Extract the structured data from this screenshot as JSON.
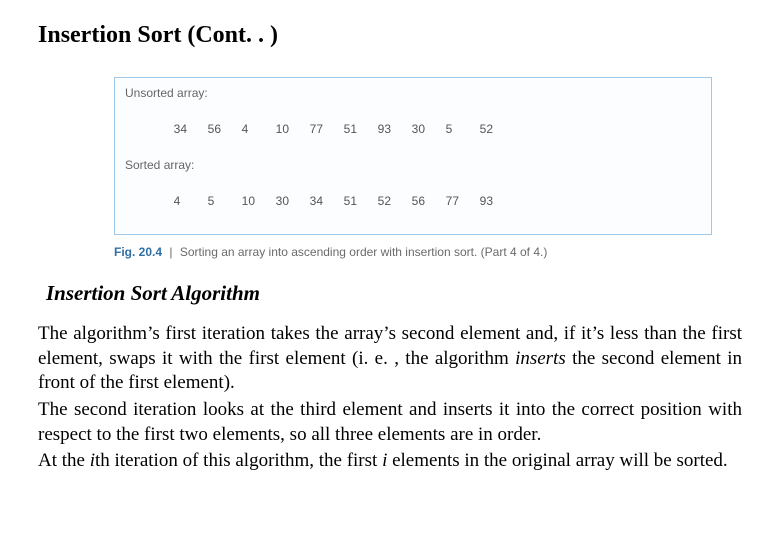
{
  "title": "Insertion Sort (Cont. . )",
  "figure": {
    "unsorted_label": "Unsorted array:",
    "unsorted_values": [
      "34",
      "56",
      "4",
      "10",
      "77",
      "51",
      "93",
      "30",
      "5",
      "52"
    ],
    "sorted_label": "Sorted array:",
    "sorted_values": [
      "4",
      "5",
      "10",
      "30",
      "34",
      "51",
      "52",
      "56",
      "77",
      "93"
    ],
    "caption_label": "Fig. 20.4",
    "caption_sep": "|",
    "caption_text": "Sorting an array into ascending order with insertion sort. (Part 4 of 4.)"
  },
  "subheading": "Insertion Sort Algorithm",
  "paragraphs": {
    "p1_a": "The algorithm’s first iteration takes the array’s second element and, if it’s less than the first element, swaps it with the first element (i. e. , the algorithm ",
    "p1_em": "inserts",
    "p1_b": " the second element in front of the first element).",
    "p2": "The second iteration looks at the third element and inserts it into the correct position with respect to the first two elements, so all three elements are in order.",
    "p3_a": "At the ",
    "p3_i1": "i",
    "p3_b": "th iteration of this algorithm, the first ",
    "p3_i2": "i",
    "p3_c": " elements in the original array will be sorted."
  }
}
